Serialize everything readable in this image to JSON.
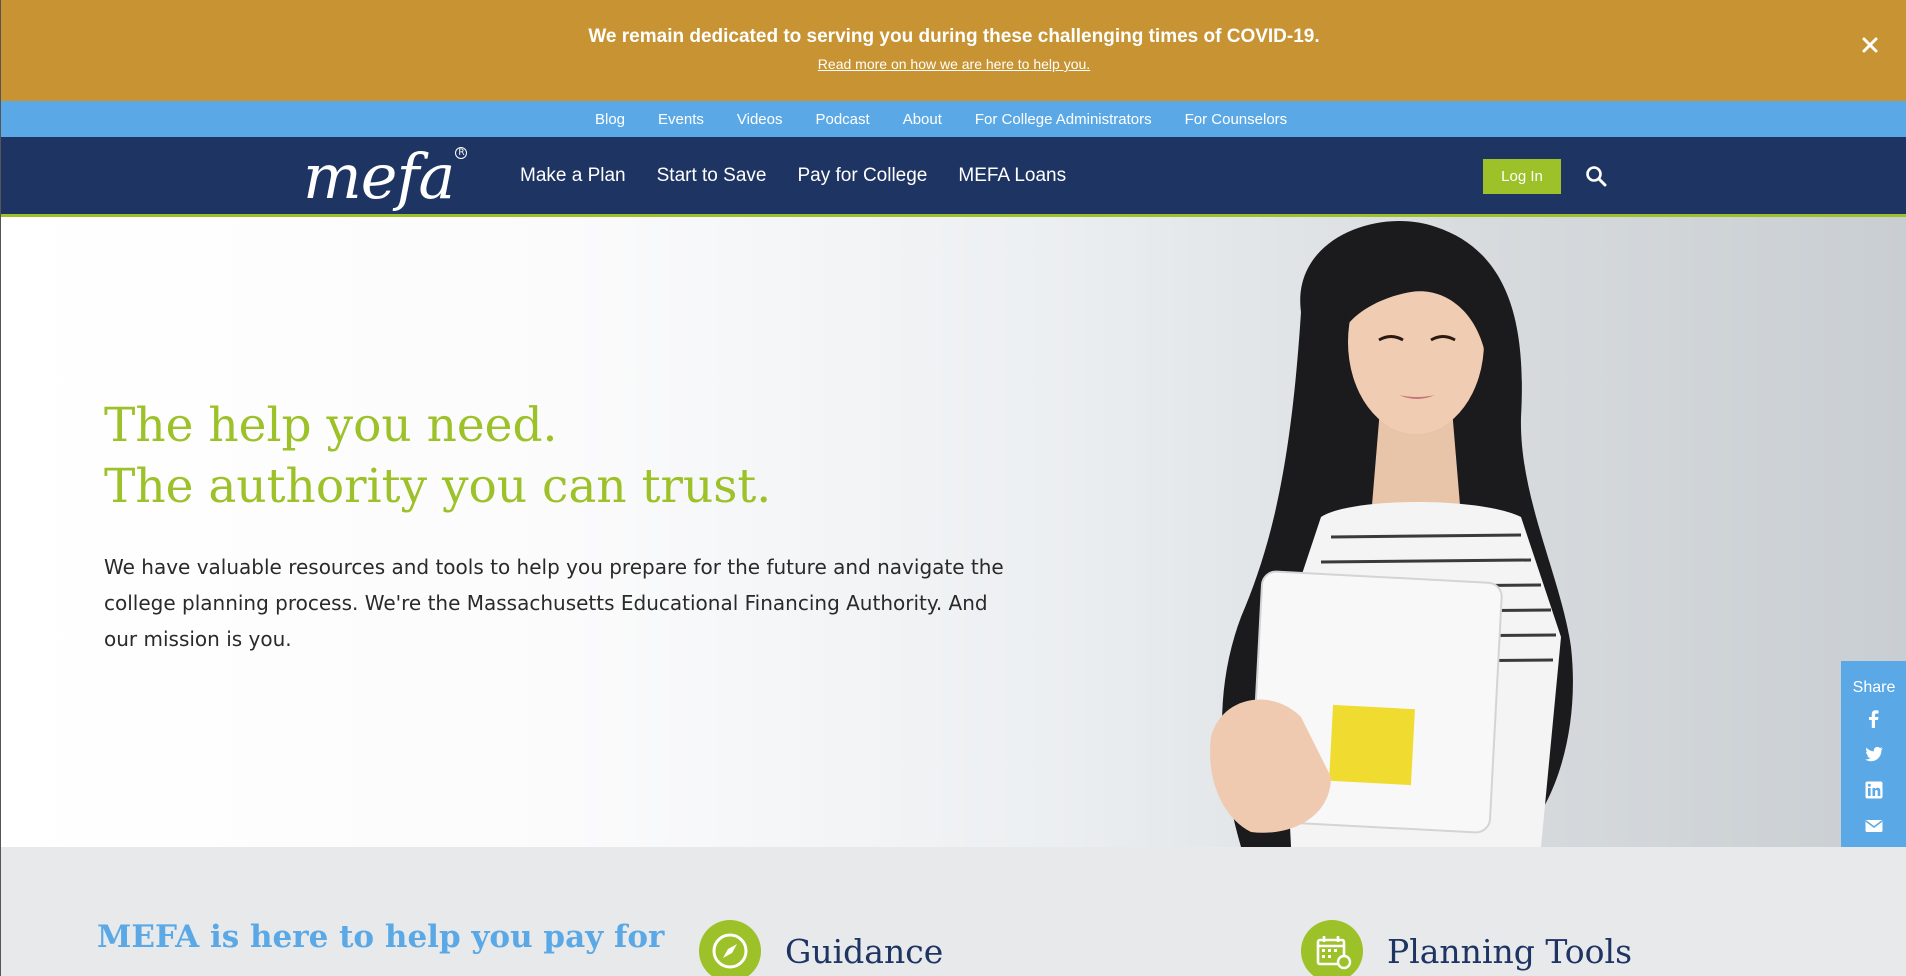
{
  "alert": {
    "message": "We remain dedicated to serving you during these challenging times of COVID-19.",
    "link": "Read more on how we are here to help you."
  },
  "utility_nav": [
    "Blog",
    "Events",
    "Videos",
    "Podcast",
    "About",
    "For College Administrators",
    "For Counselors"
  ],
  "header": {
    "logo": "mefa",
    "nav": [
      "Make a Plan",
      "Start to Save",
      "Pay for College",
      "MEFA Loans"
    ],
    "login_label": "Log In"
  },
  "hero": {
    "title_line1": "The help you need.",
    "title_line2": "The authority you can trust.",
    "body": "We have valuable resources and tools to help you prepare for the future and navigate the college planning process. We're the Massachusetts Educational Financing Authority. And our mission is you."
  },
  "share": {
    "label": "Share",
    "icons": [
      "facebook-icon",
      "twitter-icon",
      "linkedin-icon",
      "email-icon"
    ]
  },
  "features": {
    "heading": "MEFA is here to help you pay for",
    "cards": [
      {
        "title": "Guidance",
        "icon": "compass-icon"
      },
      {
        "title": "Planning Tools",
        "icon": "calendar-icon"
      }
    ]
  },
  "colors": {
    "alert_bg": "#c79333",
    "utility_bg": "#5aa9e6",
    "nav_bg": "#1e3463",
    "accent_green": "#9dc128"
  }
}
